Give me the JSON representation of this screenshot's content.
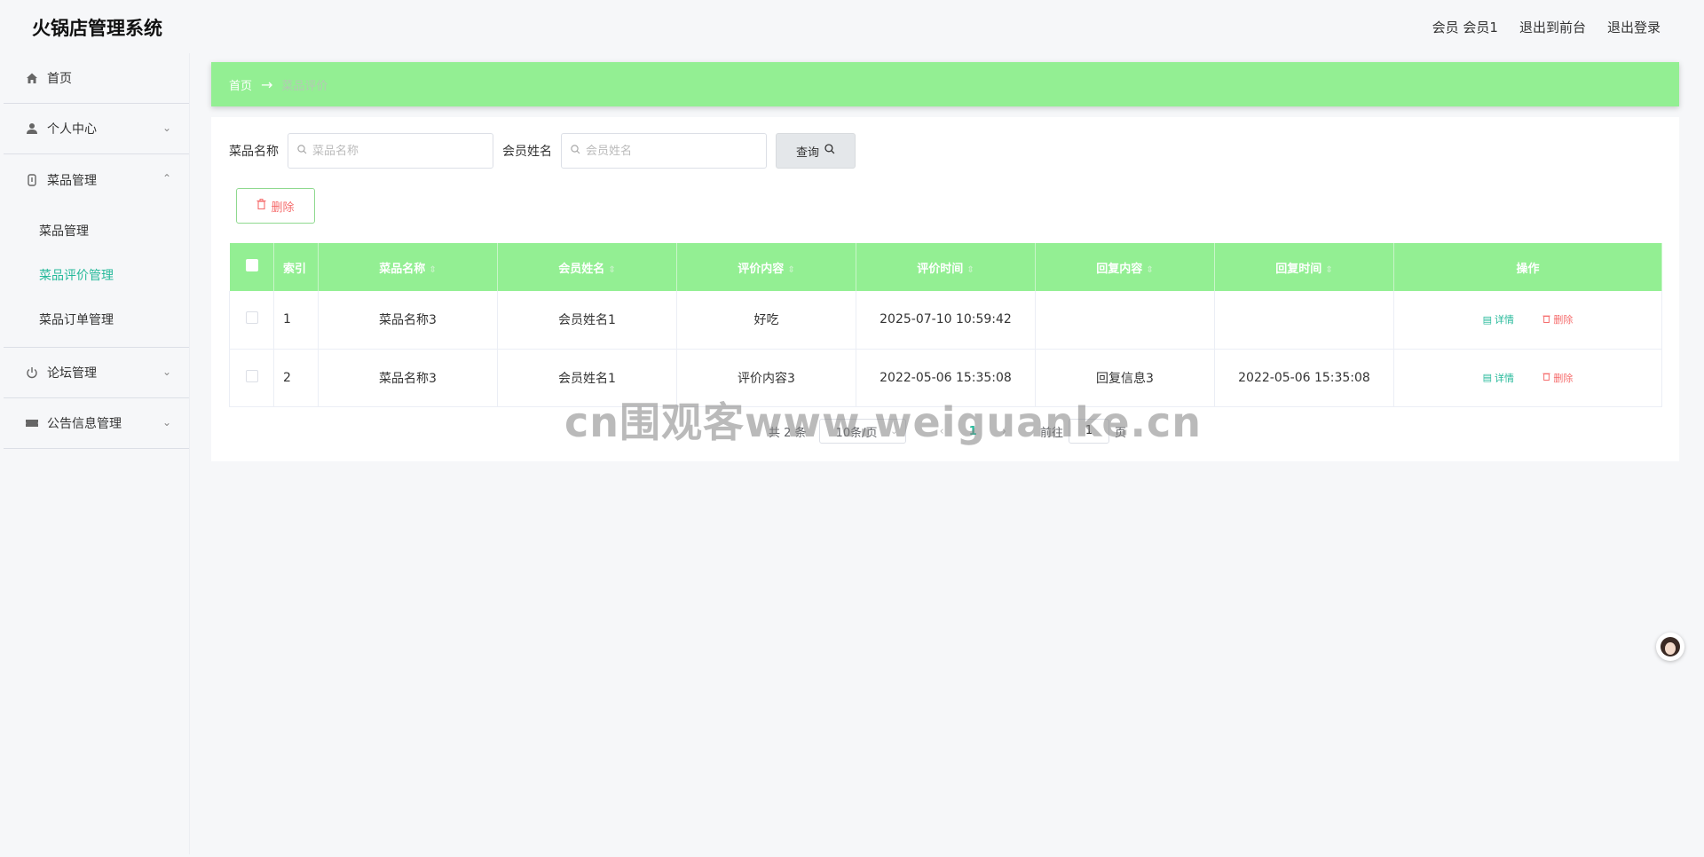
{
  "app": {
    "title": "火锅店管理系统"
  },
  "header": {
    "user_label": "会员 会员1",
    "back_to_front": "退出到前台",
    "logout": "退出登录"
  },
  "sidebar": {
    "items": [
      {
        "label": "首页",
        "icon": "home-icon"
      },
      {
        "label": "个人中心",
        "icon": "user-icon"
      },
      {
        "label": "菜品管理",
        "icon": "dish-icon",
        "children": [
          "菜品管理",
          "菜品评价管理",
          "菜品订单管理"
        ]
      },
      {
        "label": "论坛管理",
        "icon": "power-icon"
      },
      {
        "label": "公告信息管理",
        "icon": "ticket-icon"
      }
    ],
    "active_sub": "菜品评价管理"
  },
  "breadcrumb": {
    "home": "首页",
    "sep": "→",
    "current": "菜品评价"
  },
  "search": {
    "dish_label": "菜品名称",
    "dish_placeholder": "菜品名称",
    "member_label": "会员姓名",
    "member_placeholder": "会员姓名",
    "query_label": "查询"
  },
  "toolbar": {
    "delete_label": "删除"
  },
  "table": {
    "headers": [
      "索引",
      "菜品名称",
      "会员姓名",
      "评价内容",
      "评价时间",
      "回复内容",
      "回复时间",
      "操作"
    ],
    "rows": [
      {
        "index": "1",
        "dish": "菜品名称3",
        "member": "会员姓名1",
        "content": "好吃",
        "time": "2025-07-10 10:59:42",
        "reply": "",
        "reply_time": ""
      },
      {
        "index": "2",
        "dish": "菜品名称3",
        "member": "会员姓名1",
        "content": "评价内容3",
        "time": "2022-05-06 15:35:08",
        "reply": "回复信息3",
        "reply_time": "2022-05-06 15:35:08"
      }
    ],
    "detail_label": "详情",
    "remove_label": "删除"
  },
  "pagination": {
    "total": "共 2 条",
    "page_size": "10条/页",
    "prev": "‹",
    "current": "1",
    "next": "›",
    "goto_label": "前往",
    "goto_value": "1",
    "page_unit": "页"
  },
  "watermark": "cn围观客www.weiguanke.cn",
  "colors": {
    "accent": "#93ef93",
    "active_text": "#26b99a",
    "danger": "#f56c6c"
  }
}
